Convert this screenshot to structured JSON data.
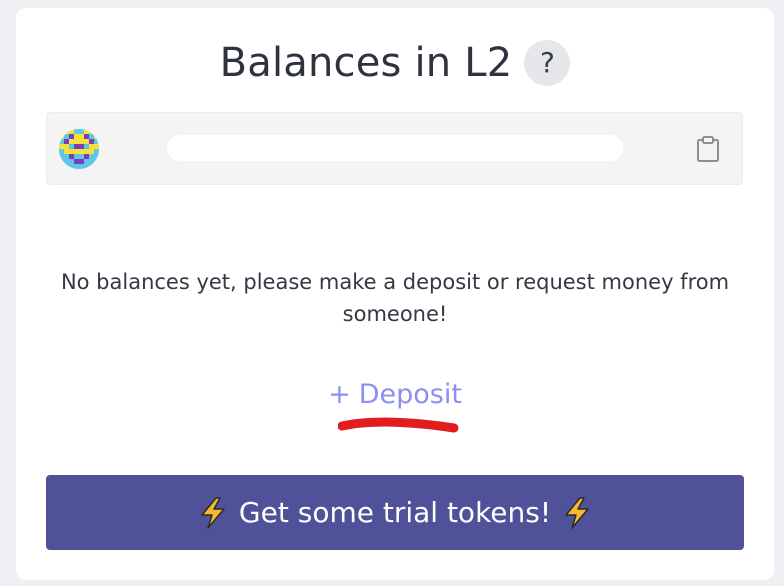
{
  "header": {
    "title": "Balances in L2",
    "help_label": "?"
  },
  "account": {
    "address": "",
    "copy_icon": "clipboard-icon"
  },
  "empty_state": {
    "message": "No balances yet, please make a deposit or request money from someone!"
  },
  "actions": {
    "deposit_plus": "+",
    "deposit_label": "Deposit",
    "trial_label": "Get some trial tokens!",
    "trial_icon": "lightning-icon"
  },
  "colors": {
    "accent": "#4f5299",
    "link": "#8a8ff0",
    "annotation": "#e11d1d"
  }
}
